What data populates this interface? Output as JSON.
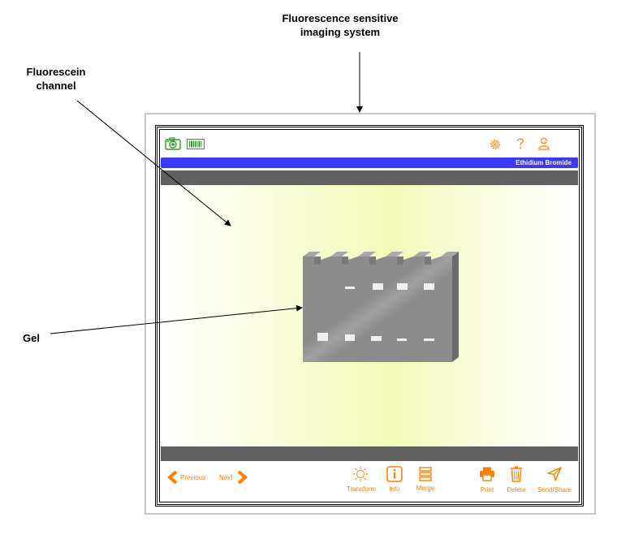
{
  "callouts": {
    "system_line1": "Fluorescence sensitive",
    "system_line2": "imaging system",
    "channel_line1": "Fluorescein",
    "channel_line2": "channel",
    "gel": "Gel"
  },
  "device": {
    "top_icons": [
      "camera-icon",
      "barcode-icon",
      "gear-icon",
      "help-icon",
      "user-icon"
    ],
    "channel_label": "Ethidium Bromide",
    "nav": {
      "previous": "Previous",
      "next": "Next"
    },
    "toolbar": {
      "transform": "Transform",
      "info": "Info",
      "merge": "Merge",
      "print": "Print",
      "delete": "Delete",
      "send_share": "Send/Share"
    }
  },
  "colors": {
    "accent": "#ff8000",
    "channel_bar": "#3a3aff",
    "gel": "#8c8c8c",
    "gel_top": "#9a9a9a",
    "gel_side": "#6b6b6b",
    "band": "#f0f0f0",
    "camera_icon": "#2e9b2e",
    "viewer_glow": "#f3f9b8",
    "dark_bar": "#606060"
  }
}
